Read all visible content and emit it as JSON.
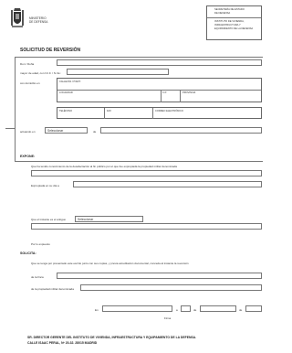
{
  "header": {
    "ministry_line1": "MINISTERIO",
    "ministry_line2": "DE DEFENSA",
    "agency_box": {
      "line1": "SECRETARÍA DE ESTADO",
      "line2": "DE DEFENSA",
      "line3": "INSTITUTO DE VIVIENDA,",
      "line4": "INFRAESTRUCTURA Y",
      "line5": "EQUIPAMIENTO DE LA DEFENSA"
    }
  },
  "title": "SOLICITUD DE REVERSIÓN",
  "personal": {
    "don_dona": "Don / Doña",
    "mayor_edad": "mayor de edad, con N.I.F. / N.I.E.:",
    "con_domicilio": "con domicilio en",
    "calle_label": "CALLE/VÍA, N°/EXT.",
    "localidad_label": "LOCALIDAD",
    "cp_label": "C.P.",
    "provincia_label": "PROVINCIA",
    "telefono_label": "TELÉFONO",
    "fax_label": "FAX",
    "correo_label": "CORREO ELECTRÓNICO",
    "actuando_en": "actuando en",
    "select_value": "Seleccionar",
    "de_label": "de"
  },
  "expone": {
    "heading": "EXPONE:",
    "line1": "Que ha tenido conocimiento de la desafectación al fin público por el que fue expropiada la propiedad militar denominada",
    "line2": "Expropiada en su día a",
    "line3": "Que el instante es el antiguo",
    "select_value": "Seleccionar",
    "line4": "Por lo expuesto"
  },
  "solicita": {
    "heading": "SOLICITA:",
    "line1": "Que se tenga por presentado este escrito junto con sus copias, y previa acreditación documental, conceda al instante la reversión",
    "line2": "de la finca",
    "line3": "de la propiedad militar denominada",
    "en_label": "En",
    "a_label": "a",
    "de_label1": "de",
    "de_label2": "de",
    "firma_label": "Firma"
  },
  "footer": {
    "line1": "SR. DIRECTOR GERENTE DEL INSTITUTO DE VIVIENDA, INFRAESTRUCTURA Y EQUIPAMIENTO DE LA DEFENSA.",
    "line2": "CALLE ISAAC PERAL, Nº 20-32. 28015 MADRID"
  }
}
